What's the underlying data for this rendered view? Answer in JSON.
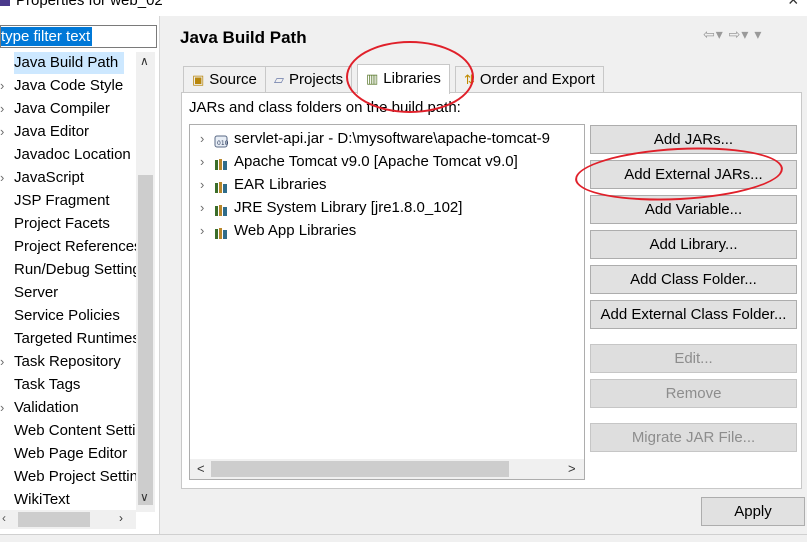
{
  "window": {
    "title": "Properties for web_02"
  },
  "filter": {
    "placeholder": "type filter text"
  },
  "tree": {
    "items": [
      {
        "label": "Java Build Path",
        "expandable": false,
        "selected": true
      },
      {
        "label": "Java Code Style",
        "expandable": true
      },
      {
        "label": "Java Compiler",
        "expandable": true
      },
      {
        "label": "Java Editor",
        "expandable": true
      },
      {
        "label": "Javadoc Location",
        "expandable": false
      },
      {
        "label": "JavaScript",
        "expandable": true
      },
      {
        "label": "JSP Fragment",
        "expandable": false
      },
      {
        "label": "Project Facets",
        "expandable": false
      },
      {
        "label": "Project References",
        "expandable": false
      },
      {
        "label": "Run/Debug Settings",
        "expandable": false
      },
      {
        "label": "Server",
        "expandable": false
      },
      {
        "label": "Service Policies",
        "expandable": false
      },
      {
        "label": "Targeted Runtimes",
        "expandable": false
      },
      {
        "label": "Task Repository",
        "expandable": true
      },
      {
        "label": "Task Tags",
        "expandable": false
      },
      {
        "label": "Validation",
        "expandable": true
      },
      {
        "label": "Web Content Settings",
        "expandable": false
      },
      {
        "label": "Web Page Editor",
        "expandable": false
      },
      {
        "label": "Web Project Settings",
        "expandable": false
      },
      {
        "label": "WikiText",
        "expandable": false
      }
    ]
  },
  "page": {
    "title": "Java Build Path"
  },
  "tabs": [
    {
      "label": "Source",
      "icon": "source-folder-icon"
    },
    {
      "label": "Projects",
      "icon": "projects-icon"
    },
    {
      "label": "Libraries",
      "icon": "libraries-icon",
      "active": true
    },
    {
      "label": "Order and Export",
      "icon": "order-export-icon"
    }
  ],
  "libraries": {
    "label": "JARs and class folders on the build path:",
    "items": [
      {
        "label": "servlet-api.jar - D:\\mysoftware\\apache-tomcat-9",
        "icon": "jar-icon"
      },
      {
        "label": "Apache Tomcat v9.0 [Apache Tomcat v9.0]",
        "icon": "library-icon"
      },
      {
        "label": "EAR Libraries",
        "icon": "library-icon"
      },
      {
        "label": "JRE System Library [jre1.8.0_102]",
        "icon": "library-icon"
      },
      {
        "label": "Web App Libraries",
        "icon": "library-icon"
      }
    ]
  },
  "buttons": {
    "add_jars": "Add JARs...",
    "add_external_jars": "Add External JARs...",
    "add_variable": "Add Variable...",
    "add_library": "Add Library...",
    "add_class_folder": "Add Class Folder...",
    "add_external_class_folder": "Add External Class Folder...",
    "edit": "Edit...",
    "remove": "Remove",
    "migrate_jar": "Migrate JAR File...",
    "apply": "Apply"
  },
  "colors": {
    "annotation": "#e0202a",
    "selection": "#0078d7",
    "tree_selected": "#cde8ff"
  }
}
